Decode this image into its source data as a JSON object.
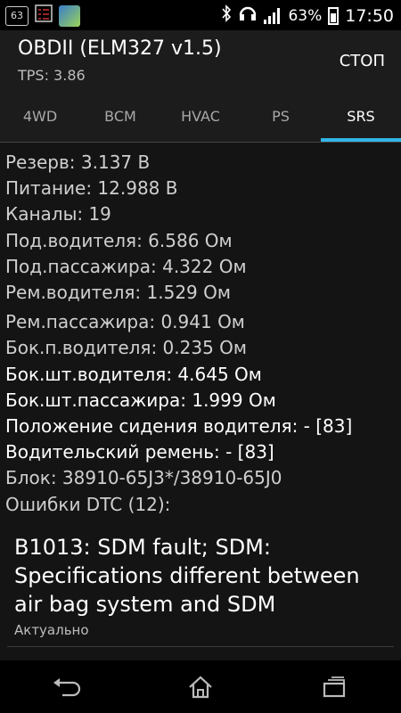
{
  "status_bar": {
    "notification_badge": "63",
    "battery_percent": "63%",
    "time": "17:50",
    "icons": [
      "notification-63-icon",
      "checklist-icon",
      "app-icon",
      "bluetooth-icon",
      "headset-icon",
      "signal-icon",
      "battery-icon"
    ]
  },
  "app_bar": {
    "title": "OBDII (ELM327 v1.5)",
    "subtitle": "TPS: 3.86",
    "stop_label": "СТОП"
  },
  "tabs": [
    {
      "label": "4WD",
      "active": false
    },
    {
      "label": "BCM",
      "active": false
    },
    {
      "label": "HVAC",
      "active": false
    },
    {
      "label": "PS",
      "active": false
    },
    {
      "label": "SRS",
      "active": true
    }
  ],
  "readings": [
    "Резерв: 3.137 В",
    "Питание: 12.988 В",
    "Каналы: 19",
    "Под.водителя: 6.586 Ом",
    "Под.пассажира: 4.322 Ом",
    "Рем.водителя: 1.529 Ом",
    "Рем.пассажира: 0.941 Ом",
    "Бок.п.водителя: 0.235 Ом",
    "Бок.шт.водителя: 4.645 Ом",
    "Бок.шт.пассажира: 1.999 Ом",
    "Положение сидения водителя: - [83]",
    "Водительский ремень: - [83]",
    "Блок: 38910-65J3*/38910-65J0",
    "Ошибки DTC (12):"
  ],
  "dtc": {
    "text": "B1013: SDM fault; SDM: Specifications different between air bag system and SDM",
    "status": "Актуально"
  },
  "colors": {
    "accent": "#33b5e5",
    "background": "#141414"
  }
}
